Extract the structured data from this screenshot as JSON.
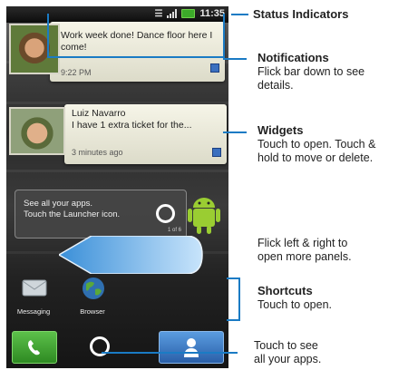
{
  "status_bar": {
    "time": "11:35"
  },
  "notifications": {
    "card1": {
      "message": "Work week done! Dance floor here I come!",
      "time": "9:22 PM"
    },
    "card2": {
      "name": "Luiz Navarro",
      "message": "I have 1 extra ticket for the...",
      "time": "3 minutes ago"
    }
  },
  "launcher_hint": {
    "line1": "See all your apps.",
    "line2": "Touch the Launcher icon.",
    "page_indicator": "1 of 6"
  },
  "shortcuts": {
    "messaging": "Messaging",
    "browser": "Browser"
  },
  "callouts": {
    "status": {
      "title": "Status Indicators"
    },
    "notifications": {
      "title": "Notifications",
      "line1": "Flick bar down to see",
      "line2": "details."
    },
    "widgets": {
      "title": "Widgets",
      "line1": "Touch to open. Touch &",
      "line2": "hold to move or delete."
    },
    "panels": {
      "line1": "Flick left & right to",
      "line2": "open more panels."
    },
    "shortcuts": {
      "title": "Shortcuts",
      "line1": "Touch to open."
    },
    "launcher": {
      "line1": "Touch to see",
      "line2": "all your apps."
    }
  },
  "colors": {
    "callout_line": "#1a7bc4",
    "phone_button": "#3a9c2e",
    "contacts_button": "#2f6fc0"
  }
}
